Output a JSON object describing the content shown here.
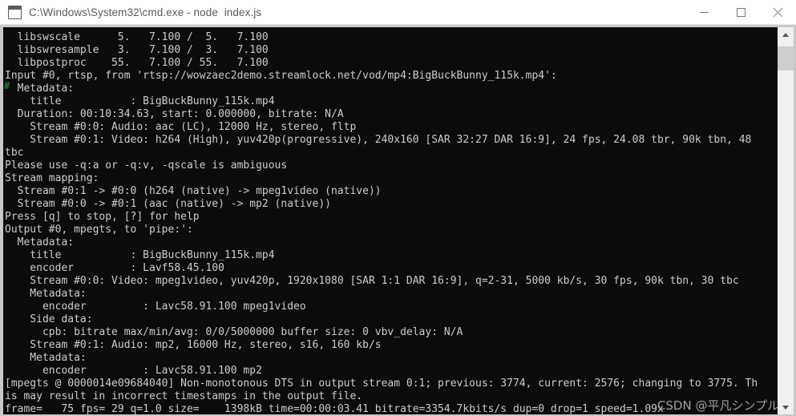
{
  "window": {
    "title": "C:\\Windows\\System32\\cmd.exe - node  index.js",
    "icon": "cmd-icon",
    "minimize_label": "–",
    "maximize_label": "□",
    "close_label": "✕"
  },
  "terminal": {
    "stray_glyph": "#",
    "lines": [
      "  libswscale      5.   7.100 /  5.   7.100",
      "  libswresample   3.   7.100 /  3.   7.100",
      "  libpostproc    55.   7.100 / 55.   7.100",
      "Input #0, rtsp, from 'rtsp://wowzaec2demo.streamlock.net/vod/mp4:BigBuckBunny_115k.mp4':",
      "  Metadata:",
      "    title           : BigBuckBunny_115k.mp4",
      "  Duration: 00:10:34.63, start: 0.000000, bitrate: N/A",
      "    Stream #0:0: Audio: aac (LC), 12000 Hz, stereo, fltp",
      "    Stream #0:1: Video: h264 (High), yuv420p(progressive), 240x160 [SAR 32:27 DAR 16:9], 24 fps, 24.08 tbr, 90k tbn, 48",
      "tbc",
      "Please use -q:a or -q:v, -qscale is ambiguous",
      "Stream mapping:",
      "  Stream #0:1 -> #0:0 (h264 (native) -> mpeg1video (native))",
      "  Stream #0:0 -> #0:1 (aac (native) -> mp2 (native))",
      "Press [q] to stop, [?] for help",
      "Output #0, mpegts, to 'pipe:':",
      "  Metadata:",
      "    title           : BigBuckBunny_115k.mp4",
      "    encoder         : Lavf58.45.100",
      "    Stream #0:0: Video: mpeg1video, yuv420p, 1920x1080 [SAR 1:1 DAR 16:9], q=2-31, 5000 kb/s, 30 fps, 90k tbn, 30 tbc",
      "    Metadata:",
      "      encoder         : Lavc58.91.100 mpeg1video",
      "    Side data:",
      "      cpb: bitrate max/min/avg: 0/0/5000000 buffer size: 0 vbv_delay: N/A",
      "    Stream #0:1: Audio: mp2, 16000 Hz, stereo, s16, 160 kb/s",
      "    Metadata:",
      "      encoder         : Lavc58.91.100 mp2",
      "[mpegts @ 0000014e09684040] Non-monotonous DTS in output stream 0:1; previous: 3774, current: 2576; changing to 3775. Th",
      "is may result in incorrect timestamps in the output file.",
      "frame=   75 fps= 29 q=1.0 size=    1398kB time=00:00:03.41 bitrate=3354.7kbits/s dup=0 drop=1 speed=1.09x"
    ]
  },
  "scrollbar": {
    "up_arrow": "scroll-up",
    "down_arrow": "scroll-down"
  },
  "watermark": {
    "text": "CSDN @平凡シンプル"
  }
}
